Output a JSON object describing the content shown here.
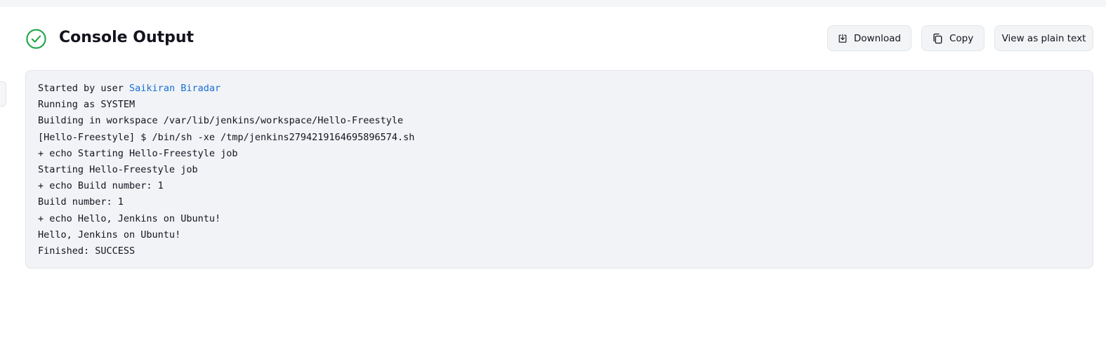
{
  "header": {
    "title": "Console Output",
    "status_icon": "success-check-circle-icon",
    "status_color": "#22a64a"
  },
  "actions": {
    "download_label": "Download",
    "download_icon": "download-icon",
    "copy_label": "Copy",
    "copy_icon": "copy-icon",
    "plain_text_label": "View as plain text"
  },
  "console": {
    "started_prefix": "Started by user ",
    "user_name": "Saikiran Biradar",
    "link_color": "#1a6fd6",
    "lines": [
      "Running as SYSTEM",
      "Building in workspace /var/lib/jenkins/workspace/Hello-Freestyle",
      "[Hello-Freestyle] $ /bin/sh -xe /tmp/jenkins2794219164695896574.sh",
      "+ echo Starting Hello-Freestyle job",
      "Starting Hello-Freestyle job",
      "+ echo Build number: 1",
      "Build number: 1",
      "+ echo Hello, Jenkins on Ubuntu!",
      "Hello, Jenkins on Ubuntu!",
      "Finished: SUCCESS"
    ]
  }
}
